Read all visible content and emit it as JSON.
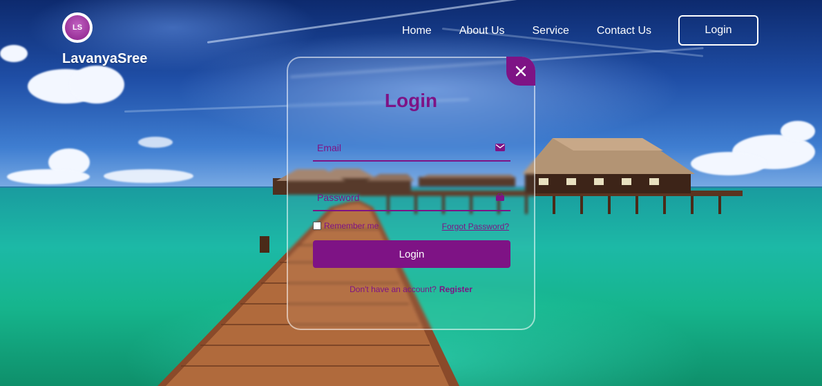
{
  "brand": {
    "logo_text": "LS",
    "name": "LavanyaSree"
  },
  "nav": {
    "items": [
      "Home",
      "About Us",
      "Service",
      "Contact Us"
    ],
    "login_button": "Login"
  },
  "login_form": {
    "title": "Login",
    "email_placeholder": "Email",
    "password_placeholder": "Password",
    "remember_label": "Remember me",
    "forgot_label": "Forgot Password?",
    "submit_label": "Login",
    "register_prompt": "Don't have an account?",
    "register_link": "Register",
    "email_icon": "envelope-icon",
    "password_icon": "lock-icon",
    "close_icon": "close-icon"
  },
  "colors": {
    "accent": "#7e1385",
    "text_light": "#ffffff"
  }
}
